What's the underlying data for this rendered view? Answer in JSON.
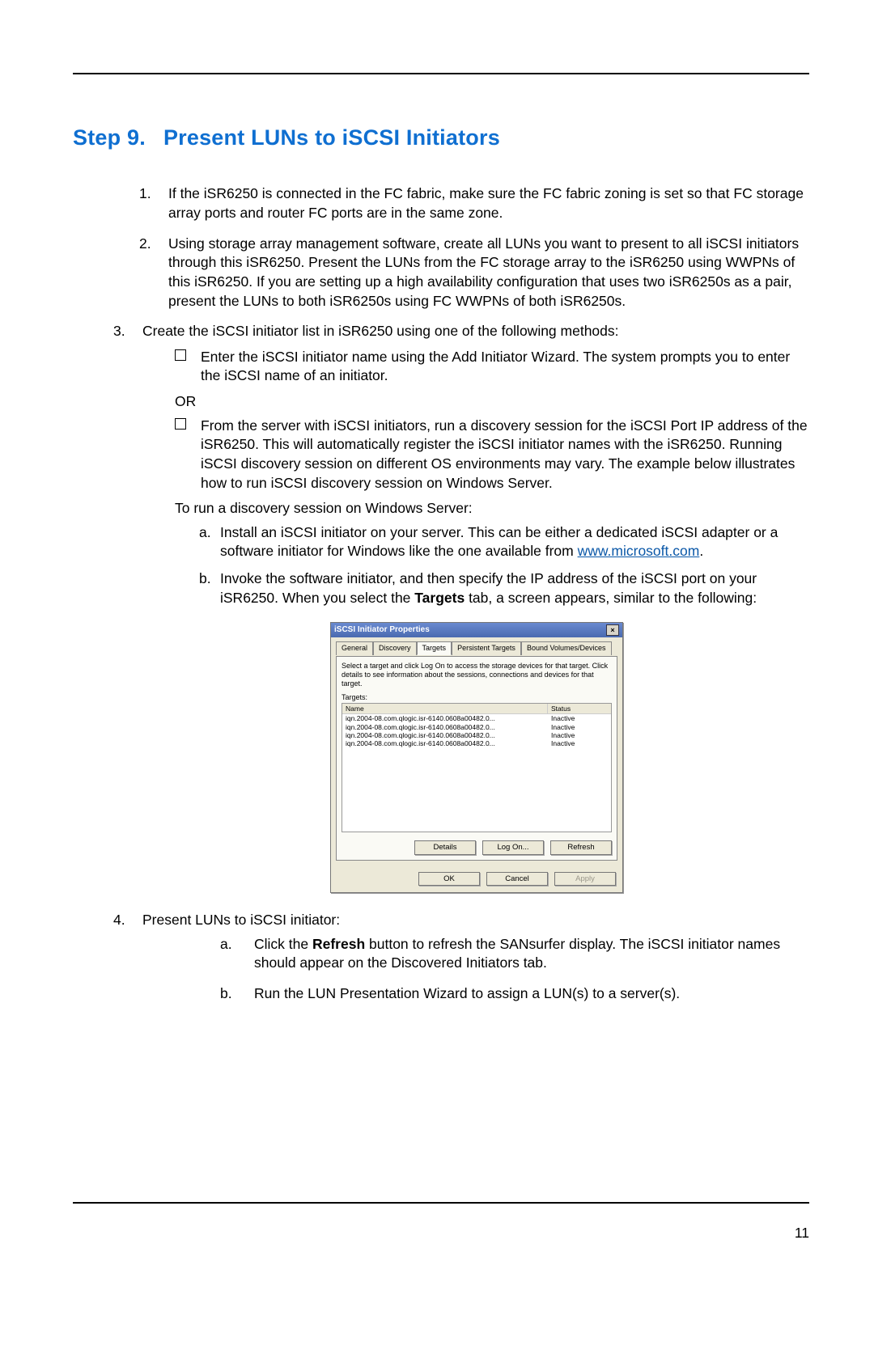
{
  "page_number": "11",
  "heading_prefix": "Step 9.",
  "heading_title": "Present LUNs to iSCSI Initiators",
  "items": {
    "n1": "1.",
    "t1": "If the iSR6250 is connected in the FC fabric, make sure the FC fabric zoning is set so that FC storage array ports and router FC ports are in the same zone.",
    "n2": "2.",
    "t2": "Using storage array management software, create all LUNs you want to present to all iSCSI initiators through this iSR6250. Present the LUNs from the FC storage array to the iSR6250 using WWPNs of this iSR6250. If you are setting up a high availability configuration that uses two iSR6250s as a pair, present the LUNs to both iSR6250s using FC WWPNs of both iSR6250s.",
    "n3": "3.",
    "t3": "Create the iSCSI initiator list in iSR6250 using one of the following methods:",
    "b1": "Enter the iSCSI initiator name using the Add Initiator Wizard. The system prompts you to enter the iSCSI name of an initiator.",
    "or": "OR",
    "b2": "From the server with iSCSI initiators, run a discovery session for the iSCSI Port IP address of the iSR6250. This will automatically register the iSCSI initiator names with the iSR6250. Running iSCSI discovery session on different OS environments may vary. The example below illustrates how to run iSCSI discovery session on Windows Server.",
    "runline": "To run a discovery session on Windows Server:",
    "a_letter": "a.",
    "a_text_pre": "Install an iSCSI initiator on your server. This can be either a dedicated iSCSI adapter or a software initiator for Windows like the one available from ",
    "a_link": "www.microsoft.com",
    "a_text_post": ".",
    "b_letter": "b.",
    "b_text_pre": "Invoke the software initiator, and then specify the IP address of the iSCSI port on your iSR6250. When you select the ",
    "b_bold": "Targets",
    "b_text_post": " tab, a screen appears, similar to the following:",
    "n4": "4.",
    "t4": "Present LUNs to iSCSI initiator:",
    "s4a_letter": "a.",
    "s4a_pre": "Click the ",
    "s4a_bold": "Refresh",
    "s4a_post": " button to refresh the SANsurfer display. The iSCSI initiator names should appear on the Discovered Initiators tab.",
    "s4b_letter": "b.",
    "s4b": "Run the LUN Presentation Wizard to assign a LUN(s) to a server(s)."
  },
  "dialog": {
    "title": "iSCSI Initiator Properties",
    "close_glyph": "×",
    "tabs": {
      "general": "General",
      "discovery": "Discovery",
      "targets": "Targets",
      "persistent": "Persistent Targets",
      "bound": "Bound Volumes/Devices"
    },
    "instruction": "Select a target and click Log On to access the storage devices for that target. Click details to see information about the sessions, connections and devices for that target.",
    "targets_label": "Targets:",
    "col_name": "Name",
    "col_status": "Status",
    "rows": [
      {
        "name": "iqn.2004-08.com.qlogic.isr-6140.0608a00482.0...",
        "status": "Inactive"
      },
      {
        "name": "iqn.2004-08.com.qlogic.isr-6140.0608a00482.0...",
        "status": "Inactive"
      },
      {
        "name": "iqn.2004-08.com.qlogic.isr-6140.0608a00482.0...",
        "status": "Inactive"
      },
      {
        "name": "iqn.2004-08.com.qlogic.isr-6140.0608a00482.0...",
        "status": "Inactive"
      }
    ],
    "btn_details": "Details",
    "btn_logon": "Log On...",
    "btn_refresh": "Refresh",
    "btn_ok": "OK",
    "btn_cancel": "Cancel",
    "btn_apply": "Apply"
  }
}
